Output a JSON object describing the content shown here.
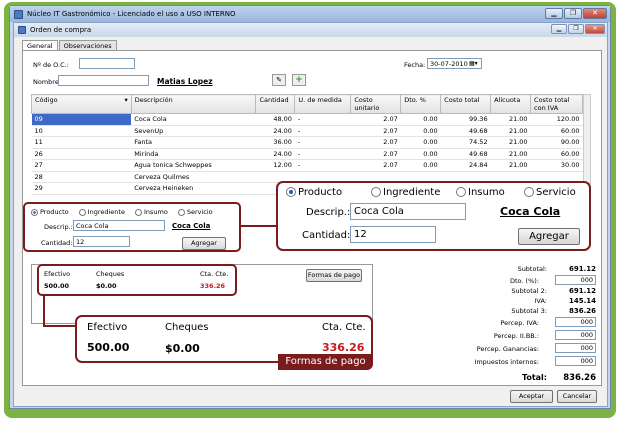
{
  "app": {
    "title": "Núcleo IT Gastronómico - Licenciado el uso a USO INTERNO",
    "window_title": "Orden de compra",
    "min_btn": "▁",
    "max_btn": "❐",
    "close_btn": "✕"
  },
  "tabs": [
    "General",
    "Observaciones"
  ],
  "header": {
    "oc_label": "Nº de O.C.:",
    "oc_value": "",
    "fecha_label": "Fecha:",
    "fecha_value": "30-07-2010",
    "nombre_label": "Nombre:",
    "nombre_value": "",
    "proveedor": "Matias Lopez"
  },
  "grid": {
    "columns": [
      "Código",
      "Descripción",
      "Cantidad",
      "U. de medida",
      "Costo unitario",
      "Dto. %",
      "Costo total",
      "Alícuota",
      "Costo total con IVA"
    ],
    "rows": [
      [
        "09",
        "Coca Cola",
        "48.00",
        "-",
        "2.07",
        "0.00",
        "99.36",
        "21.00",
        "120.00"
      ],
      [
        "10",
        "SevenUp",
        "24.00",
        "-",
        "2.07",
        "0.00",
        "49.68",
        "21.00",
        "60.00"
      ],
      [
        "11",
        "Fanta",
        "36.00",
        "-",
        "2.07",
        "0.00",
        "74.52",
        "21.00",
        "90.00"
      ],
      [
        "26",
        "Mirinda",
        "24.00",
        "-",
        "2.07",
        "0.00",
        "49.68",
        "21.00",
        "60.00"
      ],
      [
        "27",
        "Agua tonica Schweppes",
        "12.00",
        "-",
        "2.07",
        "0.00",
        "24.84",
        "21.00",
        "30.00"
      ],
      [
        "28",
        "Cerveza Quilmes",
        "",
        "",
        "",
        "",
        "",
        "",
        ""
      ],
      [
        "29",
        "Cerveza Heineken",
        "",
        "",
        "",
        "",
        "",
        "",
        ""
      ]
    ]
  },
  "item_form": {
    "radios": [
      "Producto",
      "Ingrediente",
      "Insumo",
      "Servicio"
    ],
    "selected_radio": "Producto",
    "descrip_label": "Descrip.:",
    "descrip_value": "Coca Cola",
    "descrip_link": "Coca Cola",
    "cantidad_label": "Cantidad:",
    "cantidad_value": "12",
    "agregar": "Agregar"
  },
  "payment": {
    "efectivo_label": "Efectivo",
    "cheques_label": "Cheques",
    "ctacte_label": "Cta. Cte.",
    "efectivo": "500.00",
    "cheques": "$0.00",
    "ctacte": "336.26",
    "formas_btn": "Formas de pago",
    "badge": "Formas de pago"
  },
  "totals": {
    "subtotal_label": "Subtotal:",
    "subtotal": "691.12",
    "dto_label": "Dto. (%):",
    "dto": "000",
    "subtotal2_label": "Subtotal 2:",
    "subtotal2": "691.12",
    "iva_label": "IVA:",
    "iva": "145.14",
    "subtotal3_label": "Subtotal 3:",
    "subtotal3": "836.26",
    "percep_iva_label": "Percep. IVA:",
    "percep_iva": "000",
    "percep_iibb_label": "Percep. II.BB.:",
    "percep_iibb": "000",
    "percep_gan_label": "Percep. Ganancias:",
    "percep_gan": "000",
    "imp_int_label": "Impuestos internos:",
    "imp_int": "000",
    "total_label": "Total:",
    "total": "836.26"
  },
  "footer": {
    "aceptar": "Aceptar",
    "cancelar": "Cancelar"
  },
  "colors": {
    "accent_green": "#7cb342",
    "callout": "#7a1c1c",
    "selection": "#3d6ac9",
    "red_value": "#c21c1c"
  }
}
